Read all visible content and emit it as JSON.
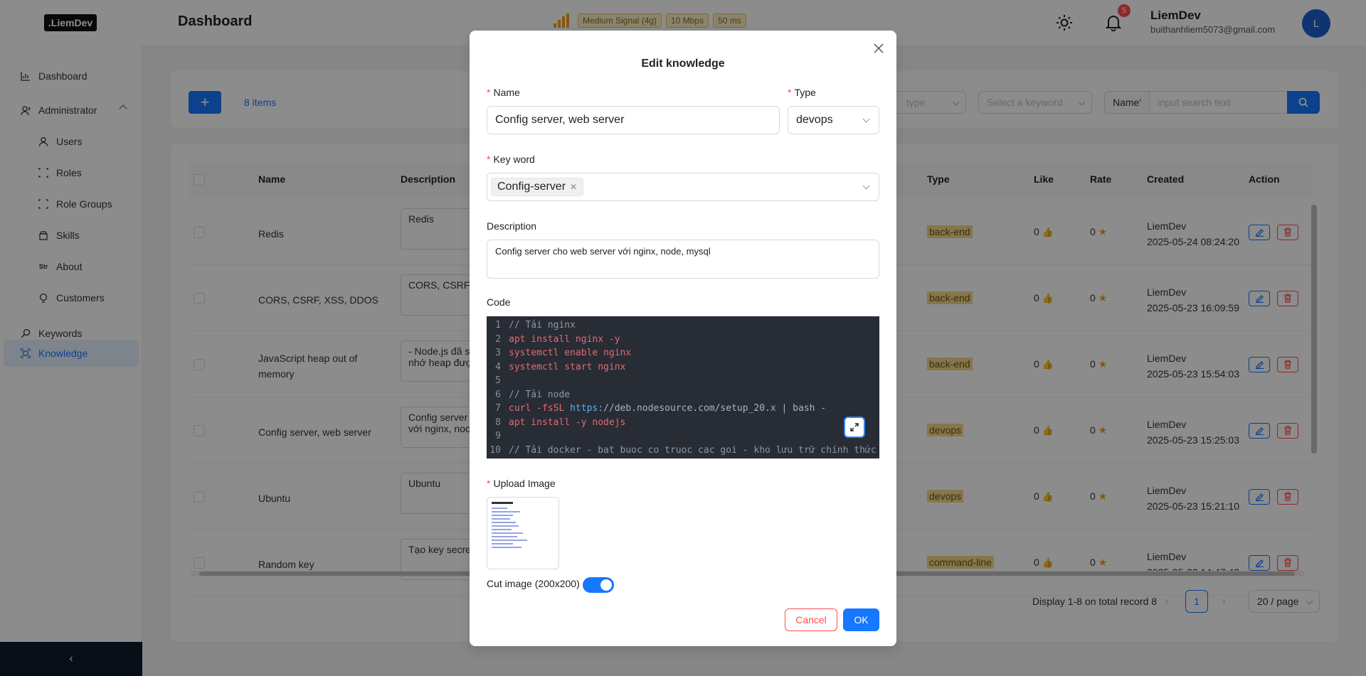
{
  "header": {
    "logo": ".LiemDev",
    "title": "Dashboard",
    "signal_label": "Medium Signal (4g)",
    "speed": "10 Mbps",
    "latency": "50 ms",
    "notification_count": "5",
    "user_name": "LiemDev",
    "user_email": "buithanhliem5073@gmail.com",
    "avatar_letter": "L"
  },
  "sidebar": {
    "items": [
      {
        "label": "Dashboard",
        "icon": "chart-icon"
      },
      {
        "label": "Administrator",
        "icon": "admin-icon"
      },
      {
        "label": "Users",
        "icon": "user-icon"
      },
      {
        "label": "Roles",
        "icon": "role-icon"
      },
      {
        "label": "Role Groups",
        "icon": "role-group-icon"
      },
      {
        "label": "Skills",
        "icon": "skill-icon"
      },
      {
        "label": "About",
        "icon": "about-icon"
      },
      {
        "label": "Customers",
        "icon": "customer-icon"
      },
      {
        "label": "Keywords",
        "icon": "key-icon"
      },
      {
        "label": "Knowledge",
        "icon": "scan-icon"
      }
    ],
    "collapse": "‹"
  },
  "toolbar": {
    "add": "+",
    "count": "8 items",
    "type_placeholder": "type",
    "keyword_placeholder": "Select a keyword",
    "search_field": "Name'",
    "search_placeholder": "input search text"
  },
  "table": {
    "columns": [
      "Name",
      "Description",
      "Type",
      "Like",
      "Rate",
      "Created",
      "Action"
    ],
    "rows": [
      {
        "name": "Redis",
        "name2": "",
        "desc": "Redis",
        "desc2": "",
        "type": "back-end",
        "like": "0",
        "rate": "0",
        "author": "LiemDev",
        "date": "2025-05-24 08:24:20"
      },
      {
        "name": "CORS, CSRF, XSS, DDOS",
        "name2": "",
        "desc": "CORS, CSRF, X",
        "desc2": "",
        "type": "back-end",
        "like": "0",
        "rate": "0",
        "author": "LiemDev",
        "date": "2025-05-23 16:09:59"
      },
      {
        "name": "JavaScript heap out of",
        "name2": "memory",
        "desc": "- Node.js đã s",
        "desc2": "nhớ heap được",
        "type": "back-end",
        "like": "0",
        "rate": "0",
        "author": "LiemDev",
        "date": "2025-05-23 15:54:03"
      },
      {
        "name": "Config server, web server",
        "name2": "",
        "desc": "Config server",
        "desc2": "với nginx, noc",
        "type": "devops",
        "like": "0",
        "rate": "0",
        "author": "LiemDev",
        "date": "2025-05-23 15:25:03"
      },
      {
        "name": "Ubuntu",
        "name2": "",
        "desc": "Ubuntu",
        "desc2": "",
        "type": "devops",
        "like": "0",
        "rate": "0",
        "author": "LiemDev",
        "date": "2025-05-23 15:21:10"
      },
      {
        "name": "Random key",
        "name2": "",
        "desc": "Tạo key secre",
        "desc2": "",
        "type": "command-line",
        "like": "0",
        "rate": "0",
        "author": "LiemDev",
        "date": "2025-05-23 14:47:42"
      }
    ]
  },
  "pagination": {
    "summary": "Display 1-8 on total record 8",
    "current": "1",
    "page_size": "20 / page"
  },
  "modal": {
    "title": "Edit knowledge",
    "name_label": "Name",
    "name_value": "Config server, web server",
    "type_label": "Type",
    "type_value": "devops",
    "keyword_label": "Key word",
    "keyword_chip": "Config-server",
    "description_label": "Description",
    "description_value": "Config server cho web server với nginx, node, mysql",
    "code_label": "Code",
    "code_lines": [
      {
        "n": "1",
        "text": "// Tải nginx",
        "kind": "comment"
      },
      {
        "n": "2",
        "text": "apt install nginx -y",
        "kind": "cmd"
      },
      {
        "n": "3",
        "text": "systemctl enable nginx",
        "kind": "cmd"
      },
      {
        "n": "4",
        "text": "systemctl start nginx",
        "kind": "cmd"
      },
      {
        "n": "5",
        "text": "",
        "kind": "plain"
      },
      {
        "n": "6",
        "text": "// Tải node",
        "kind": "comment"
      },
      {
        "n": "7",
        "text": "curl -fsSL ",
        "kind": "cmd",
        "url": "https:",
        "rest": "//deb.nodesource.com/setup_20.x | bash -"
      },
      {
        "n": "8",
        "text": "apt install -y nodejs",
        "kind": "cmd"
      },
      {
        "n": "9",
        "text": "",
        "kind": "plain"
      },
      {
        "n": "10",
        "text": "// Tải docker - bat buoc co truoc cac goi - kho lưu trữ chính thức",
        "kind": "comment"
      }
    ],
    "upload_label": "Upload Image",
    "cut_label": "Cut image (200x200)",
    "cancel": "Cancel",
    "ok": "OK"
  },
  "colors": {
    "primary": "#1677ff",
    "danger": "#ff4d4f",
    "tag": "#f5d889",
    "code_bg": "#282c34"
  }
}
